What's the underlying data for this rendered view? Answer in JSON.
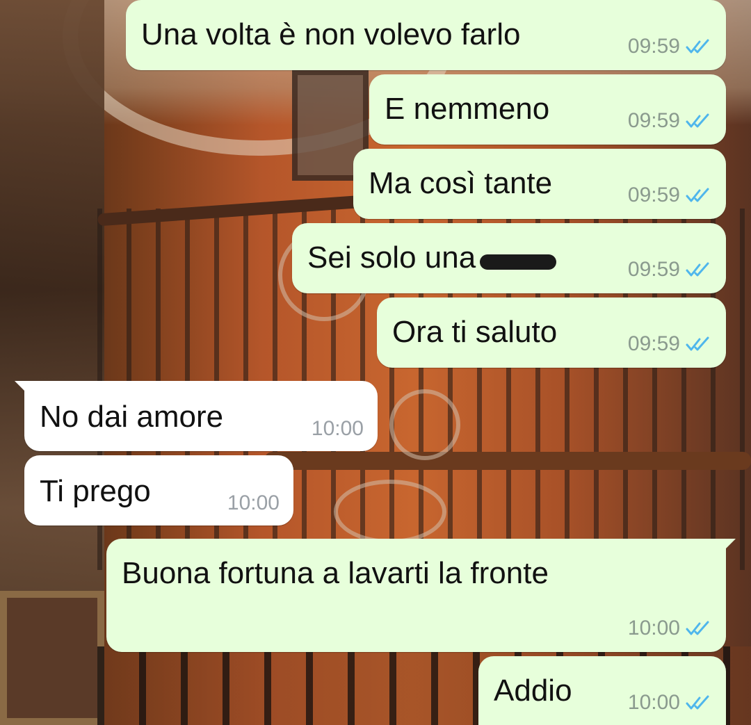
{
  "icons": {
    "read_receipt": "double-check-icon"
  },
  "colors": {
    "outgoing_bubble": "#e7ffdb",
    "incoming_bubble": "#ffffff",
    "read_ticks": "#4fb6ec",
    "time_text": "#8a9a8e"
  },
  "messages": [
    {
      "direction": "outgoing",
      "text": "Una volta è non volevo farlo",
      "time": "09:59"
    },
    {
      "direction": "outgoing",
      "text": "E nemmeno",
      "time": "09:59"
    },
    {
      "direction": "outgoing",
      "text": "Ma così tante",
      "time": "09:59"
    },
    {
      "direction": "outgoing",
      "text": "Sei solo una",
      "time": "09:59"
    },
    {
      "direction": "outgoing",
      "text": "Ora ti saluto",
      "time": "09:59"
    },
    {
      "direction": "incoming",
      "text": "No dai amore",
      "time": "10:00"
    },
    {
      "direction": "incoming",
      "text": "Ti prego",
      "time": "10:00"
    },
    {
      "direction": "outgoing",
      "text": "Buona fortuna a lavarti la fronte",
      "time": "10:00"
    },
    {
      "direction": "outgoing",
      "text": "Addio",
      "time": "10:00"
    }
  ]
}
